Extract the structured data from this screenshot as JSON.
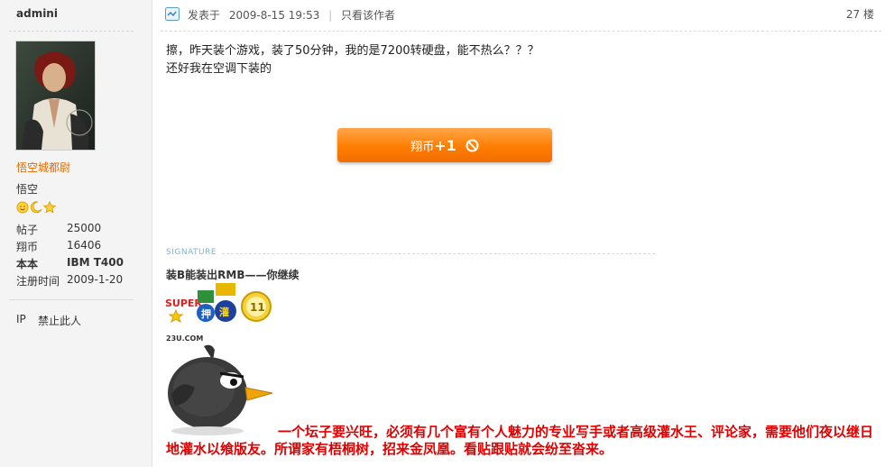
{
  "user": {
    "name": "admini",
    "rank_title": "悟空城都尉",
    "nickname": "悟空",
    "stats": [
      {
        "label": "帖子",
        "value": "25000"
      },
      {
        "label": "翔币",
        "value": "16406"
      },
      {
        "label": "本本",
        "value": "IBM T400"
      },
      {
        "label": "注册时间",
        "value": "2009-1-20"
      }
    ],
    "ip_label": "IP",
    "ban_label": "禁止此人"
  },
  "post": {
    "posted_label": "发表于",
    "posted_time": "2009-8-15 19:53",
    "author_only_label": "只看该作者",
    "floor": "27 楼",
    "lines": [
      "擦，昨天装个游戏，装了50分钟，我的是7200转硬盘，能不热么？？？",
      "还好我在空调下装的"
    ],
    "rate_button": {
      "currency": "翔币",
      "amount": "+1"
    }
  },
  "signature": {
    "label": "SIGNATURE",
    "text": "装B能装出RMB——你继续",
    "badge_text": [
      "SUPER",
      "押",
      "灌",
      "11"
    ],
    "site_label": "23U.COM",
    "slogan": "一个坛子要兴旺，必须有几个富有个人魅力的专业写手或者高级灌水王、评论家，需要他们夜以继日地灌水以飨版友。所谓家有梧桐树，招来金凤凰。看贴跟贴就会纷至沓来。"
  },
  "colors": {
    "rank_title": "#e06b00",
    "button": "#ff7e00",
    "slogan": "#e00000"
  }
}
